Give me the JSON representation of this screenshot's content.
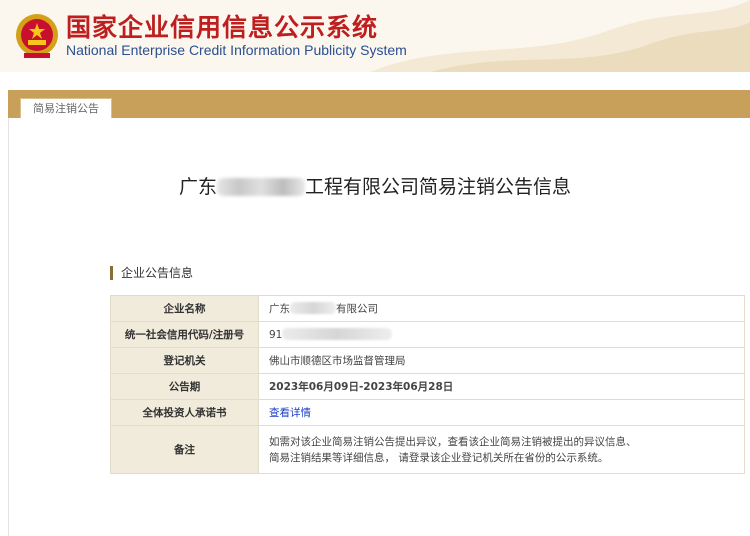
{
  "header": {
    "title_cn": "国家企业信用信息公示系统",
    "title_en": "National Enterprise Credit Information Publicity System"
  },
  "tab": {
    "label": "简易注销公告"
  },
  "page": {
    "title_prefix": "广东",
    "title_suffix": "工程有限公司简易注销公告信息"
  },
  "section": {
    "label": "企业公告信息"
  },
  "table": {
    "rows": [
      {
        "key": "企业名称",
        "value_prefix": "广东",
        "value_suffix": "有限公司"
      },
      {
        "key": "统一社会信用代码/注册号",
        "value_prefix": "91"
      },
      {
        "key": "登记机关",
        "value": "佛山市顺德区市场监督管理局"
      },
      {
        "key": "公告期",
        "value": "2023年06月09日-2023年06月28日"
      },
      {
        "key": "全体投资人承诺书",
        "value": "查看详情"
      },
      {
        "key": "备注",
        "line1": "如需对该企业简易注销公告提出异议，查看该企业简易注销被提出的异议信息、",
        "line2": "简易注销结果等详细信息， 请登录该企业登记机关所在省份的公示系统。"
      }
    ]
  },
  "colors": {
    "brand_red": "#bf1e1e",
    "tab_gold": "#c9a05a",
    "link_blue": "#1a3fc9",
    "alert_red": "#d9001b"
  }
}
